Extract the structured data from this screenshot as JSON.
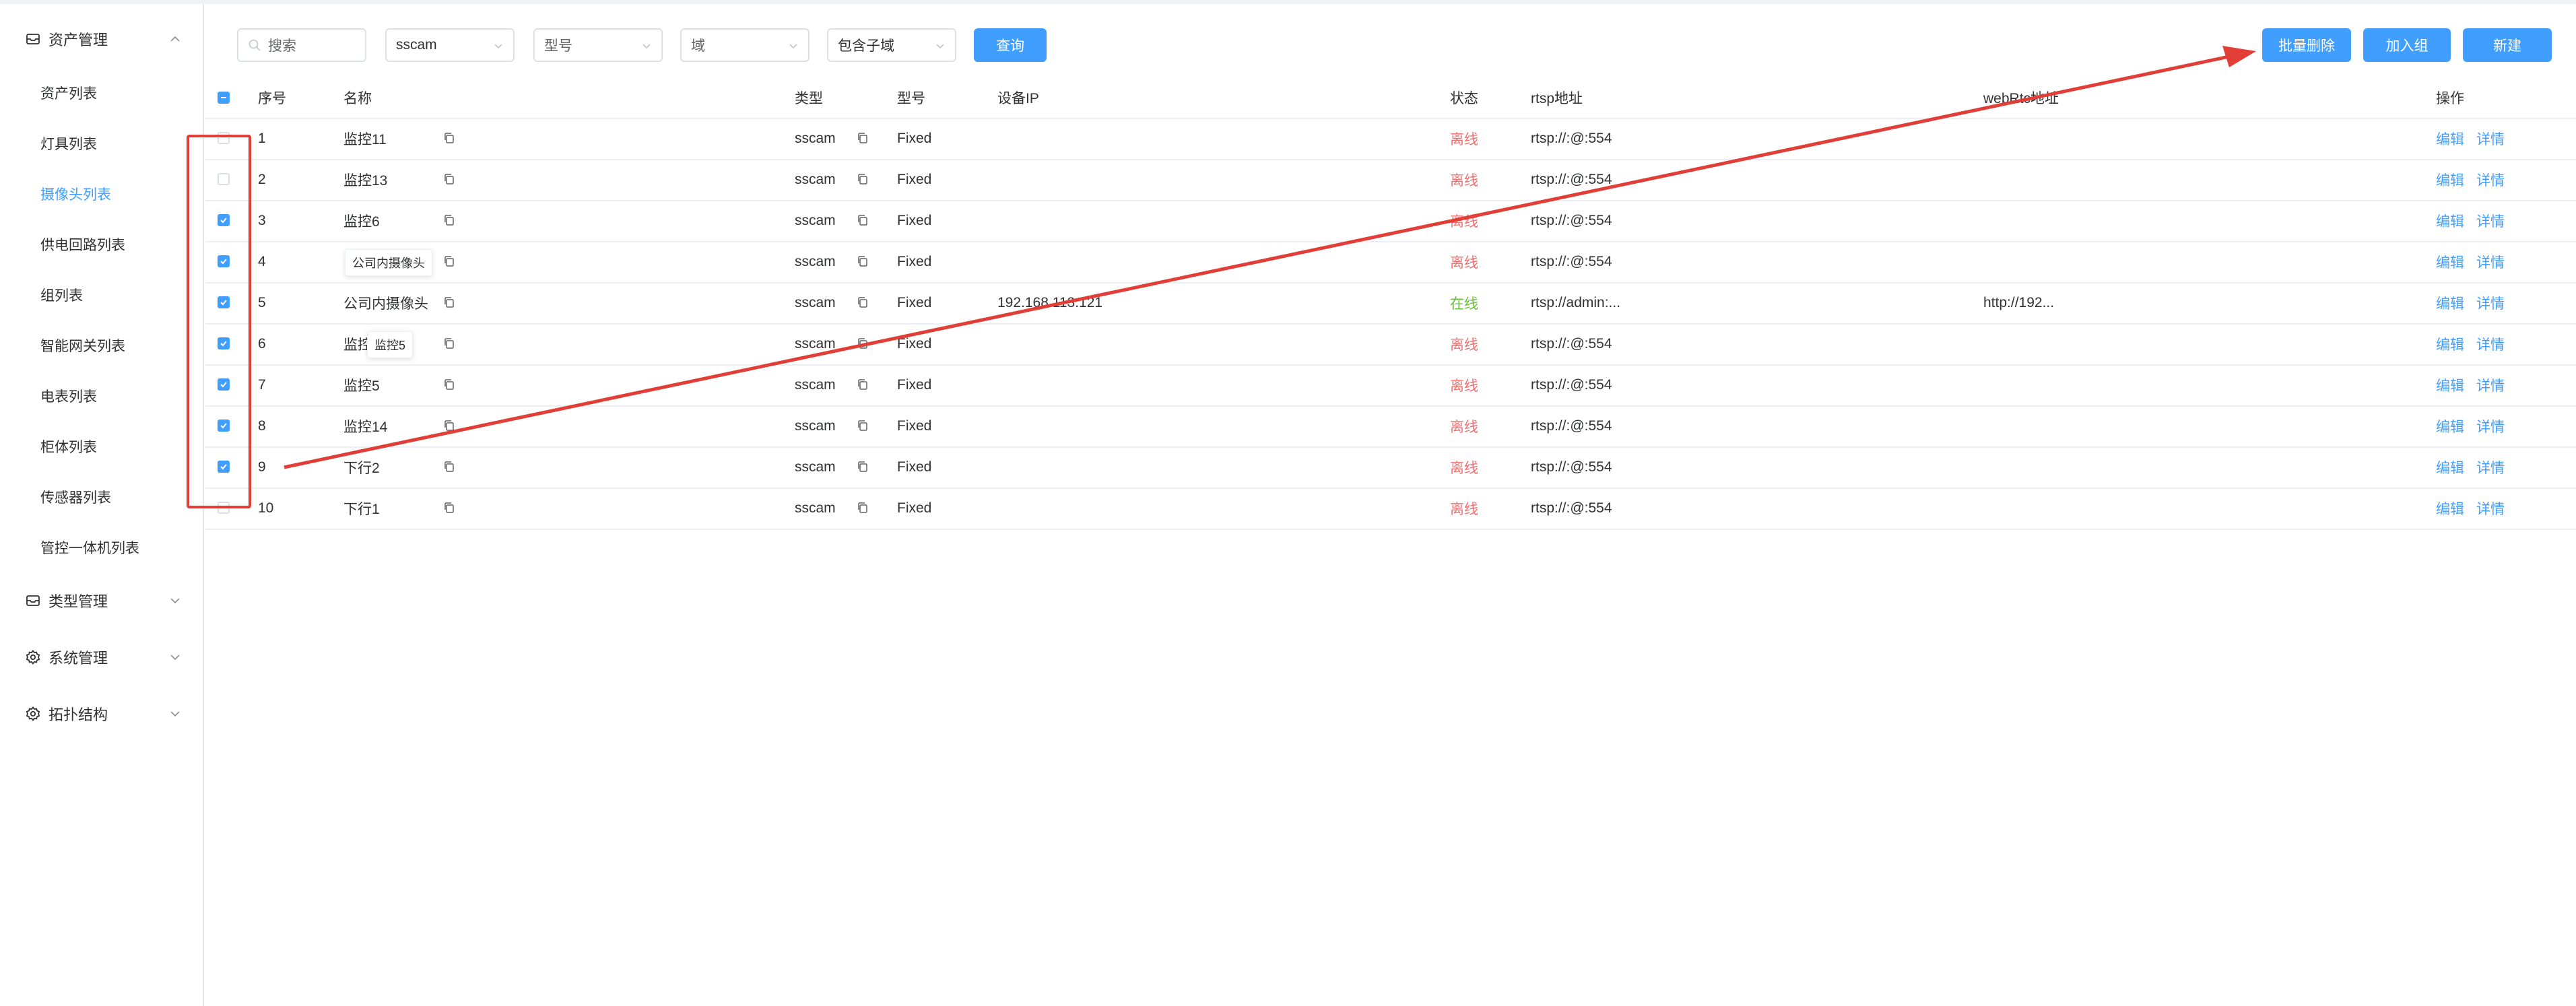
{
  "sidebar": {
    "groups": [
      {
        "label": "资产管理",
        "icon": "archive-icon",
        "expanded": true
      },
      {
        "label": "类型管理",
        "icon": "archive-icon",
        "expanded": false
      },
      {
        "label": "系统管理",
        "icon": "gear-icon",
        "expanded": false
      },
      {
        "label": "拓扑结构",
        "icon": "gear-icon",
        "expanded": false
      }
    ],
    "items": [
      {
        "label": "资产列表"
      },
      {
        "label": "灯具列表"
      },
      {
        "label": "摄像头列表",
        "active": true
      },
      {
        "label": "供电回路列表"
      },
      {
        "label": "组列表"
      },
      {
        "label": "智能网关列表"
      },
      {
        "label": "电表列表"
      },
      {
        "label": "柜体列表"
      },
      {
        "label": "传感器列表"
      },
      {
        "label": "管控一体机列表"
      }
    ]
  },
  "toolbar": {
    "search_placeholder": "搜索",
    "type_value": "sscam",
    "model_placeholder": "型号",
    "domain_placeholder": "域",
    "subdomain_label": "包含子域",
    "query_label": "查询",
    "batch_delete_label": "批量删除",
    "join_group_label": "加入组",
    "new_label": "新建"
  },
  "table": {
    "headers": {
      "index": "序号",
      "name": "名称",
      "type": "类型",
      "model": "型号",
      "ip": "设备IP",
      "status": "状态",
      "rtsp": "rtsp地址",
      "webrtc": "webRtc地址",
      "actions": "操作"
    },
    "header_checkbox": "indeterminate",
    "edit_label": "编辑",
    "detail_label": "详情",
    "rows": [
      {
        "index": "1",
        "name": "监控11",
        "type": "sscam",
        "model": "Fixed",
        "ip": "",
        "status": "离线",
        "online": false,
        "rtsp": "rtsp://:@:554",
        "webrtc": "",
        "checked": false
      },
      {
        "index": "2",
        "name": "监控13",
        "type": "sscam",
        "model": "Fixed",
        "ip": "",
        "status": "离线",
        "online": false,
        "rtsp": "rtsp://:@:554",
        "webrtc": "",
        "checked": false
      },
      {
        "index": "3",
        "name": "监控6",
        "type": "sscam",
        "model": "Fixed",
        "ip": "",
        "status": "离线",
        "online": false,
        "rtsp": "rtsp://:@:554",
        "webrtc": "",
        "checked": true
      },
      {
        "index": "4",
        "name": "",
        "type": "sscam",
        "model": "Fixed",
        "ip": "",
        "status": "离线",
        "online": false,
        "rtsp": "rtsp://:@:554",
        "webrtc": "",
        "checked": true
      },
      {
        "index": "5",
        "name": "公司内摄像头",
        "type": "sscam",
        "model": "Fixed",
        "ip": "192.168.113.121",
        "status": "在线",
        "online": true,
        "rtsp": "rtsp://admin:...",
        "webrtc": "http://192...",
        "checked": true
      },
      {
        "index": "6",
        "name": "监控",
        "type": "sscam",
        "model": "Fixed",
        "ip": "",
        "status": "离线",
        "online": false,
        "rtsp": "rtsp://:@:554",
        "webrtc": "",
        "checked": true
      },
      {
        "index": "7",
        "name": "监控5",
        "type": "sscam",
        "model": "Fixed",
        "ip": "",
        "status": "离线",
        "online": false,
        "rtsp": "rtsp://:@:554",
        "webrtc": "",
        "checked": true
      },
      {
        "index": "8",
        "name": "监控14",
        "type": "sscam",
        "model": "Fixed",
        "ip": "",
        "status": "离线",
        "online": false,
        "rtsp": "rtsp://:@:554",
        "webrtc": "",
        "checked": true
      },
      {
        "index": "9",
        "name": "下行2",
        "type": "sscam",
        "model": "Fixed",
        "ip": "",
        "status": "离线",
        "online": false,
        "rtsp": "rtsp://:@:554",
        "webrtc": "",
        "checked": true
      },
      {
        "index": "10",
        "name": "下行1",
        "type": "sscam",
        "model": "Fixed",
        "ip": "",
        "status": "离线",
        "online": false,
        "rtsp": "rtsp://:@:554",
        "webrtc": "",
        "checked": false
      }
    ],
    "tooltips": [
      {
        "text": "公司内摄像头"
      },
      {
        "text": "监控5"
      }
    ]
  },
  "colors": {
    "accent": "#409eff",
    "offline": "#f56c6c",
    "online": "#67c23a",
    "annotation": "#e03e36"
  }
}
